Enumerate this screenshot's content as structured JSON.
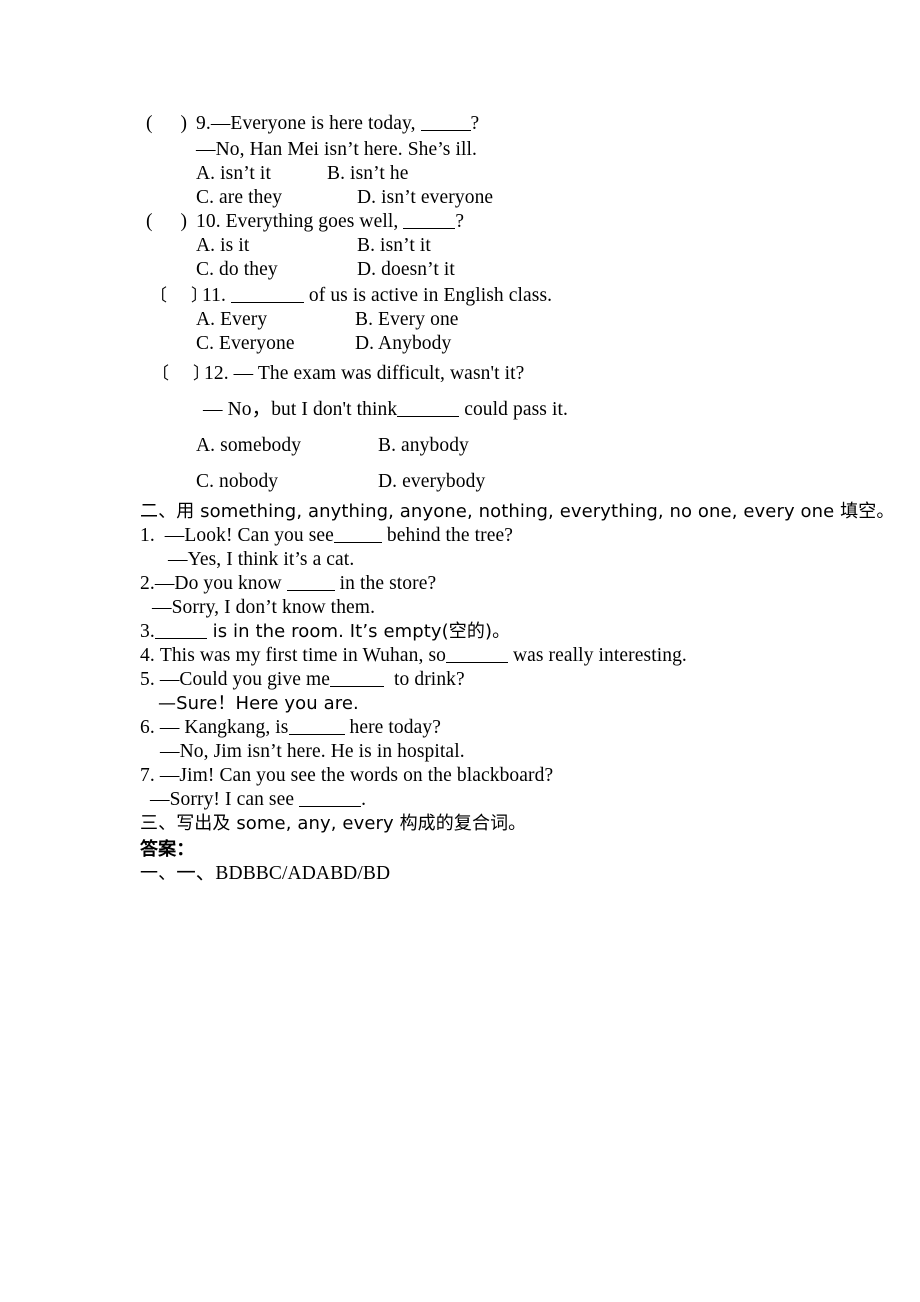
{
  "document": {
    "type": "english-grammar-worksheet",
    "language_note": "Chinese / English bilingual exercise sheet"
  },
  "section_one": {
    "questions": [
      {
        "bracket_open": "(",
        "bracket_close": ")",
        "number": "9.",
        "stem": "—Everyone is here today, ",
        "stem_tail": "?",
        "stem_second_line": "—No, Han Mei isn’t here. She’s ill.",
        "options": {
          "a": "A. isn’t it",
          "b": "B. isn’t he",
          "c": "C. are they",
          "d": "D. isn’t everyone"
        }
      },
      {
        "bracket_open": "(",
        "bracket_close": ")",
        "number": "10.",
        "stem": "Everything goes well, ",
        "stem_tail": "?",
        "options": {
          "a": "A. is it",
          "b": "B. isn’t it",
          "c": "C. do they",
          "d": "D. doesn’t it"
        }
      },
      {
        "bracket_open": "〔",
        "bracket_close": "〕",
        "number": "11.",
        "stem": "",
        "stem_tail": " of us is active in English class.",
        "options": {
          "a": "A. Every",
          "b": "B. Every one",
          "c": "C. Everyone",
          "d": "D. Anybody"
        }
      },
      {
        "bracket_open": "〔",
        "bracket_close": "〕",
        "number": "12.",
        "stem": "— The exam was difficult, wasn't it?",
        "stem_second_line_pre": "— No，but I don't think",
        "stem_second_line_post": " could pass it.",
        "options": {
          "a": "A. somebody",
          "b": "B. anybody",
          "c": "C. nobody",
          "d": "D. everybody"
        }
      }
    ]
  },
  "section_two": {
    "heading": "二、用 something, anything, anyone, nothing, everything, no one, every one 填空。",
    "items": [
      {
        "number": "1.",
        "pre": "—Look! Can you see",
        "post": " behind the tree?",
        "second": "—Yes, I think it’s a cat."
      },
      {
        "number": "2.",
        "pre": "—Do you know ",
        "post": " in the store?",
        "second": "—Sorry, I don’t know them."
      },
      {
        "number": "3.",
        "pre": "",
        "post": " is in the room. It’s empty(空的)。",
        "second": ""
      },
      {
        "number": "4.",
        "pre": "This was my first time in Wuhan, so",
        "post": " was really interesting.",
        "second": ""
      },
      {
        "number": "5.",
        "pre": "—Could you give me",
        "post": "  to drink?",
        "second": "—Sure！Here you are."
      },
      {
        "number": "6.",
        "pre": "— Kangkang, is",
        "post": " here today?",
        "second": "—No, Jim isn’t here. He is in hospital."
      },
      {
        "number": "7.",
        "pre": "—Jim! Can you see the words on the blackboard?",
        "post": "",
        "second_pre": "—Sorry! I can see ",
        "second_post": "."
      }
    ]
  },
  "section_three": {
    "heading": "三、写出及 some, any, every 构成的复合词。"
  },
  "answers": {
    "heading": "答案：",
    "line_one": "一、BDBBC/ADABD/BD"
  }
}
